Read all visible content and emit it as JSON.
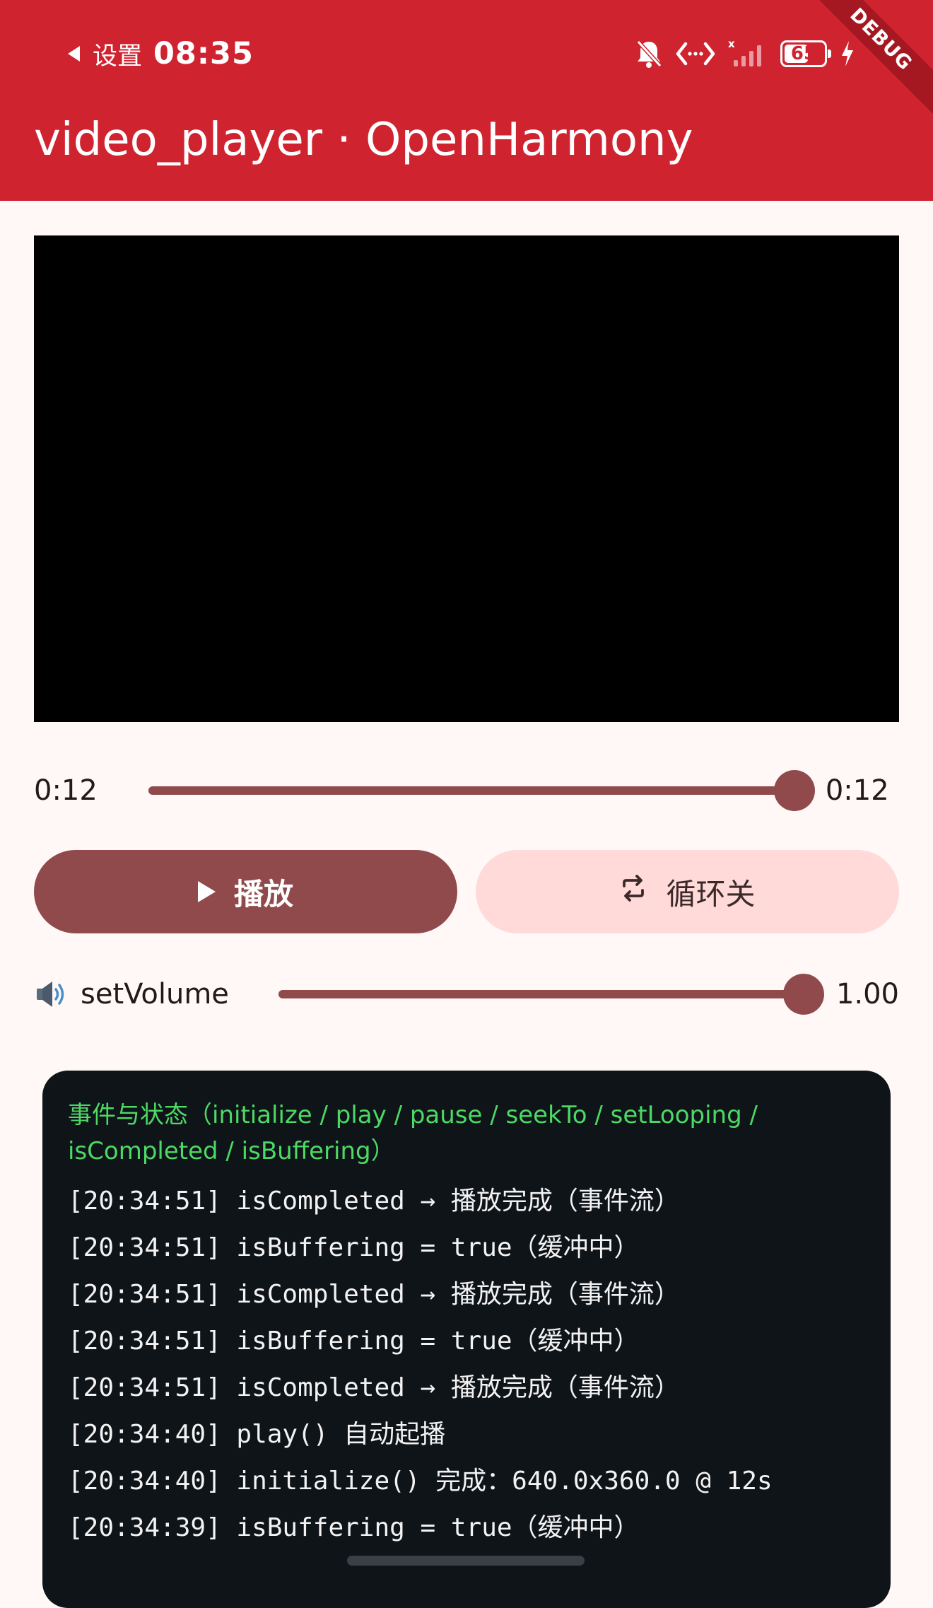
{
  "status_bar": {
    "carrier_label": "设置",
    "time": "08:35",
    "battery_level": "65",
    "battery_fraction": 0.65,
    "icons": [
      "bell-off-icon",
      "data-transfer-icon",
      "no-signal-icon",
      "battery-icon",
      "charging-icon"
    ],
    "debug_label": "DEBUG"
  },
  "app_bar": {
    "title": "video_player · OpenHarmony",
    "color": "#d02330"
  },
  "player": {
    "position": "0:12",
    "duration": "0:12",
    "progress_fraction": 1.0
  },
  "controls": {
    "play_label": "播放",
    "play_icon": "play-icon",
    "loop_label": "循环关",
    "loop_icon": "repeat-icon",
    "accent_color": "#904a4b",
    "tonal_color": "#ffdad8"
  },
  "volume": {
    "icon": "speaker-icon",
    "label": "setVolume",
    "value": "1.00",
    "fraction": 1.0
  },
  "log": {
    "header": "事件与状态（initialize / play / pause / seekTo / setLooping / isCompleted / isBuffering）",
    "header_color": "#4cd964",
    "lines": [
      "[20:34:51] isCompleted → 播放完成（事件流）",
      "[20:34:51] isBuffering = true（缓冲中）",
      "[20:34:51] isCompleted → 播放完成（事件流）",
      "[20:34:51] isBuffering = true（缓冲中）",
      "[20:34:51] isCompleted → 播放完成（事件流）",
      "[20:34:40] play() 自动起播",
      "[20:34:40] initialize() 完成：640.0x360.0 @ 12s",
      "[20:34:39] isBuffering = true（缓冲中）"
    ]
  }
}
